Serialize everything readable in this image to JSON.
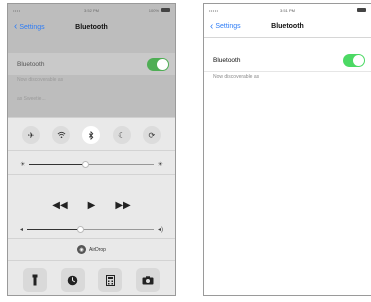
{
  "left_phone": {
    "status": {
      "carrier": "•••• ",
      "time": "3:52 PM",
      "battery_text": "100%"
    },
    "nav": {
      "back_label": "Settings",
      "title": "Bluetooth"
    },
    "bluetooth_label": "Bluetooth",
    "discoverable_text": "Now discoverable as",
    "extra_text": "as Sweetie...",
    "control_center": {
      "toggles": [
        {
          "icon": "airplane-icon"
        },
        {
          "icon": "wifi-icon"
        },
        {
          "icon": "bluetooth-icon",
          "active": true
        },
        {
          "icon": "do-not-disturb-icon"
        },
        {
          "icon": "rotation-lock-icon"
        }
      ],
      "brightness_level": 0.45,
      "volume_level": 0.42,
      "airdrop_label": "AirDrop",
      "quick_tiles": [
        {
          "icon": "flashlight-icon"
        },
        {
          "icon": "timer-icon"
        },
        {
          "icon": "calculator-icon"
        },
        {
          "icon": "camera-icon"
        }
      ]
    }
  },
  "right_phone": {
    "status": {
      "carrier": "•••••",
      "time": "3:51 PM",
      "battery_text": ""
    },
    "nav": {
      "back_label": "Settings",
      "title": "Bluetooth"
    },
    "bluetooth_label": "Bluetooth",
    "discoverable_text": "Now discoverable as"
  },
  "colors": {
    "accent": "#2d7cf6",
    "toggle_on": "#4cd964"
  }
}
